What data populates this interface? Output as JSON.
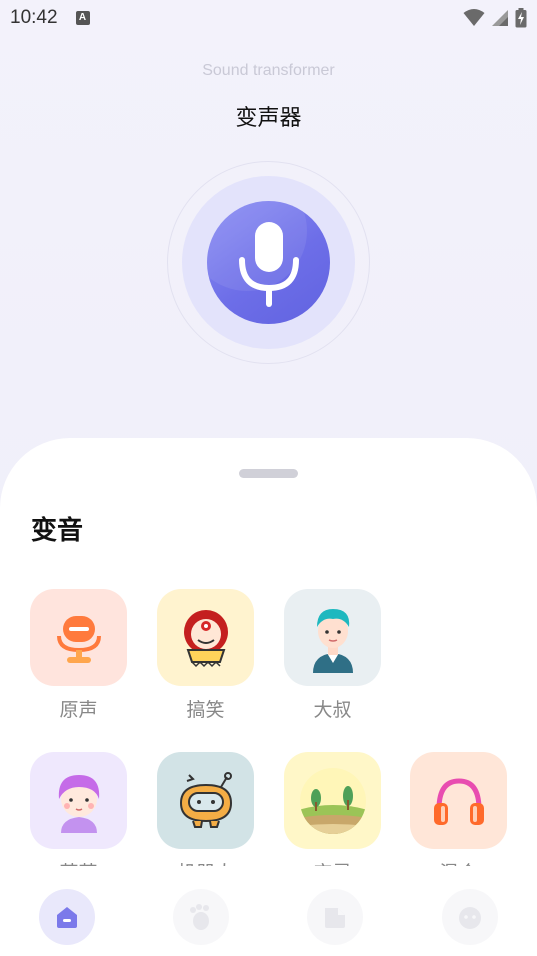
{
  "status_bar": {
    "time": "10:42",
    "notification_icon": "A"
  },
  "header": {
    "subtitle": "Sound transformer",
    "title": "变声器"
  },
  "mic": {
    "icon": "microphone-icon",
    "accent": "#6d6ee8"
  },
  "sheet": {
    "section_title": "变音",
    "effects": [
      {
        "label": "原声",
        "icon": "microphone-original-icon",
        "tile_color": "#ffe4dd"
      },
      {
        "label": "搞笑",
        "icon": "clown-icon",
        "tile_color": "#fff3cf"
      },
      {
        "label": "大叔",
        "icon": "uncle-avatar-icon",
        "tile_color": "#e9eff2"
      },
      {
        "label": "萌萌",
        "icon": "girl-avatar-icon",
        "tile_color": "#efe8fd"
      },
      {
        "label": "机器人",
        "icon": "robot-icon",
        "tile_color": "#d2e3e6"
      },
      {
        "label": "空灵",
        "icon": "landscape-icon",
        "tile_color": "#fff7c8"
      },
      {
        "label": "混合",
        "icon": "headphones-icon",
        "tile_color": "#ffe6d8"
      }
    ]
  },
  "bottom_nav": {
    "items": [
      {
        "icon": "home-icon",
        "active": true
      },
      {
        "icon": "footprint-icon",
        "active": false
      },
      {
        "icon": "folder-icon",
        "active": false
      },
      {
        "icon": "face-icon",
        "active": false
      }
    ]
  }
}
